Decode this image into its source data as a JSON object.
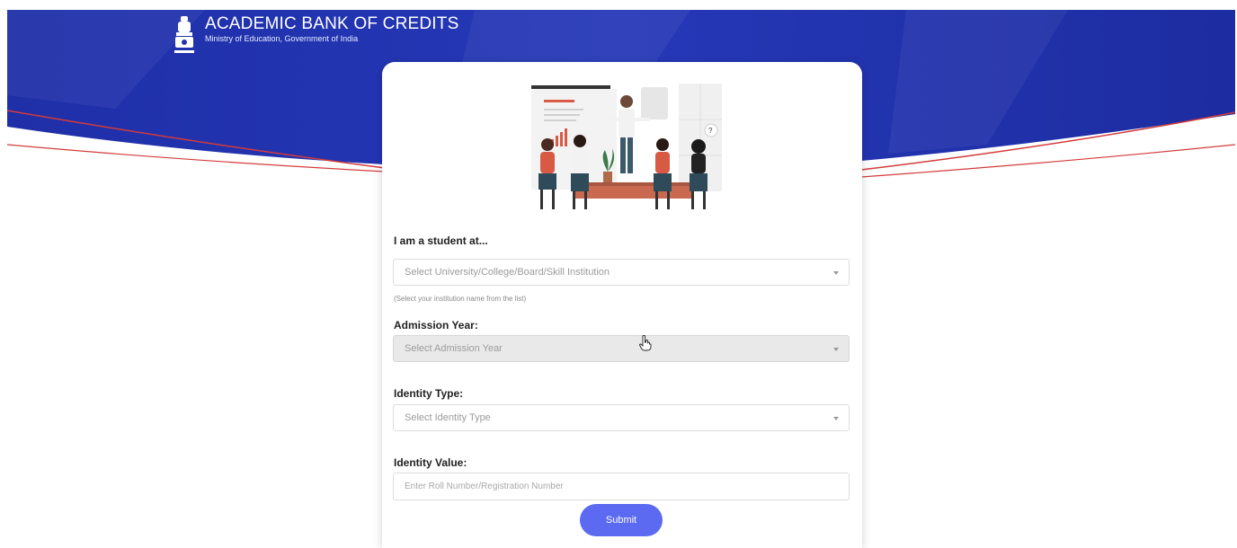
{
  "header": {
    "title": "ACADEMIC BANK OF CREDITS",
    "subtitle": "Ministry of Education, Government of India",
    "emblem_icon": "national-emblem-icon"
  },
  "form": {
    "illustration_icon": "classroom-presentation-illustration",
    "institution": {
      "label": "I am a student at...",
      "placeholder": "Select University/College/Board/Skill Institution",
      "hint": "(Select your institution name from the list)"
    },
    "admission_year": {
      "label": "Admission Year:",
      "placeholder": "Select Admission Year"
    },
    "identity_type": {
      "label": "Identity Type:",
      "placeholder": "Select Identity Type"
    },
    "identity_value": {
      "label": "Identity Value:",
      "placeholder": "Enter Roll Number/Registration Number"
    },
    "submit_label": "Submit"
  },
  "colors": {
    "banner_blue": "#2233b0",
    "accent_red": "#d33b3b",
    "button": "#5b6af0"
  }
}
